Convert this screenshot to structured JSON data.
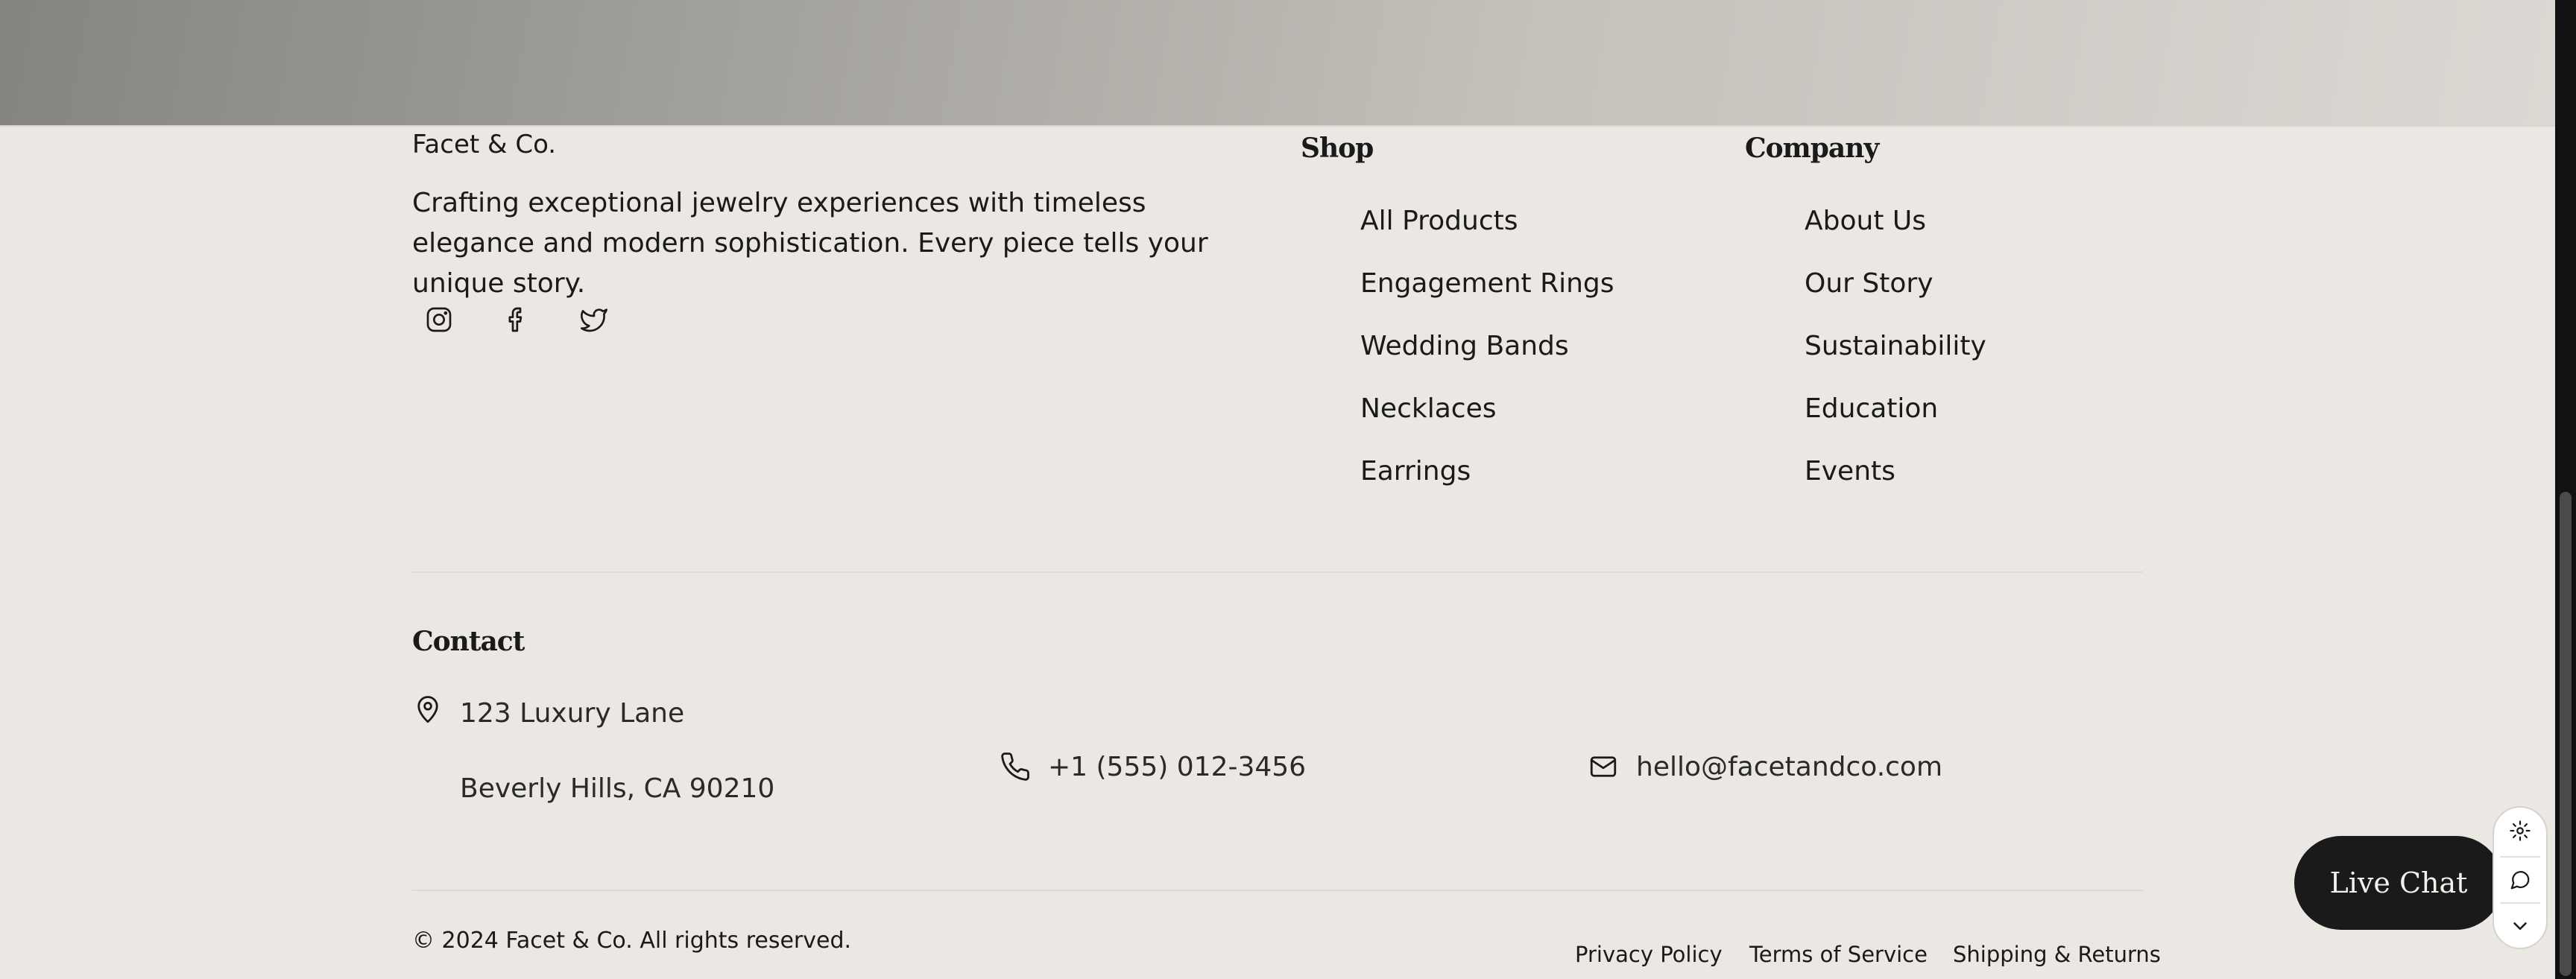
{
  "brand": {
    "name": "Facet & Co.",
    "tagline": "Crafting exceptional jewelry experiences with timeless elegance and modern sophistication. Every piece tells your unique story."
  },
  "social": [
    {
      "icon": "instagram-icon"
    },
    {
      "icon": "facebook-icon"
    },
    {
      "icon": "twitter-icon"
    }
  ],
  "shop": {
    "heading": "Shop",
    "items": [
      "All Products",
      "Engagement Rings",
      "Wedding Bands",
      "Necklaces",
      "Earrings"
    ]
  },
  "company": {
    "heading": "Company",
    "items": [
      "About Us",
      "Our Story",
      "Sustainability",
      "Education",
      "Events"
    ]
  },
  "contact": {
    "heading": "Contact",
    "address_line1": "123 Luxury Lane",
    "address_line2": "Beverly Hills, CA 90210",
    "phone": "+1 (555) 012-3456",
    "email": "hello@facetandco.com"
  },
  "footer": {
    "copyright": "© 2024 Facet & Co. All rights reserved.",
    "links": [
      "Privacy Policy",
      "Terms of Service",
      "Shipping & Returns"
    ]
  },
  "chat": {
    "label": "Live Chat"
  },
  "widget": {
    "icons": [
      "gear-icon",
      "chat-bubble-icon",
      "chevron-down-icon"
    ]
  },
  "colors": {
    "background": "#ebe8e3",
    "text": "#1a1a1a",
    "chat_button": "#1a1a1a"
  }
}
